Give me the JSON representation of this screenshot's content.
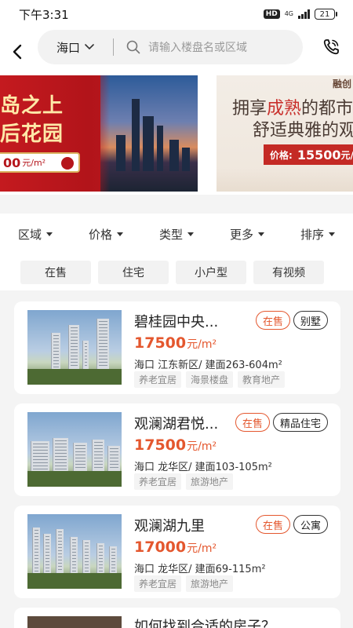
{
  "status_bar": {
    "time": "下午3:31",
    "hd": "HD",
    "network": "4G",
    "battery": "21"
  },
  "header": {
    "back_icon": "chevron-left-icon",
    "city": "海口",
    "search_placeholder": "请输入楼盘名或区域",
    "phone_icon": "phone-icon"
  },
  "banner": {
    "slide1": {
      "line1": "岛之上",
      "line2": "后花园",
      "price": "00",
      "price_unit": "元/m²"
    },
    "slide2": {
      "logo": "融创",
      "line1_a": "拥享",
      "line1_hl": "成熟",
      "line1_b": "的都市",
      "line2": "舒适典雅的观",
      "price_label": "价格:",
      "price_value": "15500",
      "price_unit": "元/"
    }
  },
  "filters": [
    {
      "label": "区域"
    },
    {
      "label": "价格"
    },
    {
      "label": "类型"
    },
    {
      "label": "更多"
    },
    {
      "label": "排序"
    }
  ],
  "quick_tags": [
    {
      "label": "在售"
    },
    {
      "label": "住宅"
    },
    {
      "label": "小户型"
    },
    {
      "label": "有视频"
    }
  ],
  "listings": [
    {
      "name": "碧桂园中央...",
      "status": "在售",
      "kind": "别墅",
      "price": "17500",
      "unit": "元/m²",
      "location": "海口 江东新区/ 建面263-604m²",
      "tags": [
        "养老宜居",
        "海景楼盘",
        "教育地产"
      ]
    },
    {
      "name": "观澜湖君悦...",
      "status": "在售",
      "kind": "精品住宅",
      "price": "17500",
      "unit": "元/m²",
      "location": "海口 龙华区/ 建面103-105m²",
      "tags": [
        "养老宜居",
        "旅游地产"
      ]
    },
    {
      "name": "观澜湖九里",
      "status": "在售",
      "kind": "公寓",
      "price": "17000",
      "unit": "元/m²",
      "location": "海口 龙华区/ 建面69-115m²",
      "tags": [
        "养老宜居",
        "旅游地产"
      ]
    },
    {
      "name": "如何找到合适的房子？"
    }
  ]
}
